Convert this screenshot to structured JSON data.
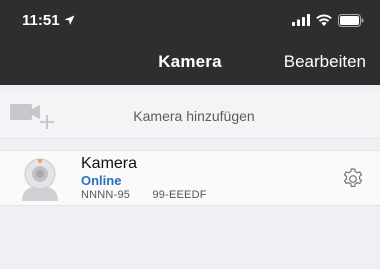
{
  "status_bar": {
    "time": "11:51",
    "icons": [
      "location-arrow-icon",
      "cellular-signal-icon",
      "wifi-icon",
      "battery-icon"
    ]
  },
  "nav": {
    "title": "Kamera",
    "edit_label": "Bearbeiten"
  },
  "add_camera": {
    "label": "Kamera hinzufügen",
    "icon": "add-camera-icon"
  },
  "cameras": [
    {
      "name": "Kamera",
      "status": "Online",
      "device_id": "NNNN-95  99-EEEDF",
      "icon": "camera-avatar-icon",
      "settings_icon": "gear-icon"
    }
  ],
  "colors": {
    "header_bg": "#2e2e2e",
    "page_bg": "#efeff4",
    "online_status": "#2f6fbf",
    "icon_gray": "#c8c8cc"
  }
}
